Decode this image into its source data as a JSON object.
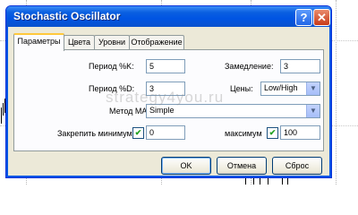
{
  "window": {
    "title": "Stochastic Oscillator",
    "help_glyph": "?",
    "close_glyph": "✕"
  },
  "tabs": [
    {
      "label": "Параметры",
      "active": true
    },
    {
      "label": "Цвета",
      "active": false
    },
    {
      "label": "Уровни",
      "active": false
    },
    {
      "label": "Отображение",
      "active": false
    }
  ],
  "params": {
    "k_period_label": "Период %K:",
    "k_period_value": "5",
    "slowing_label": "Замедление:",
    "slowing_value": "3",
    "d_period_label": "Период %D:",
    "d_period_value": "3",
    "price_label": "Цены:",
    "price_value": "Low/High",
    "ma_method_label": "Метод MA:",
    "ma_method_value": "Simple",
    "fix_min_label": "Закрепить минимум",
    "fix_min_checked": true,
    "fix_min_value": "0",
    "fix_max_label": "максимум",
    "fix_max_checked": true,
    "fix_max_value": "100"
  },
  "buttons": {
    "ok": "OK",
    "cancel": "Отмена",
    "reset": "Сброс"
  },
  "watermark": "strategy4you.ru",
  "colors": {
    "title_bar": "#0054e3",
    "dialog_face": "#ece9d8",
    "check_mark": "#21a121"
  }
}
